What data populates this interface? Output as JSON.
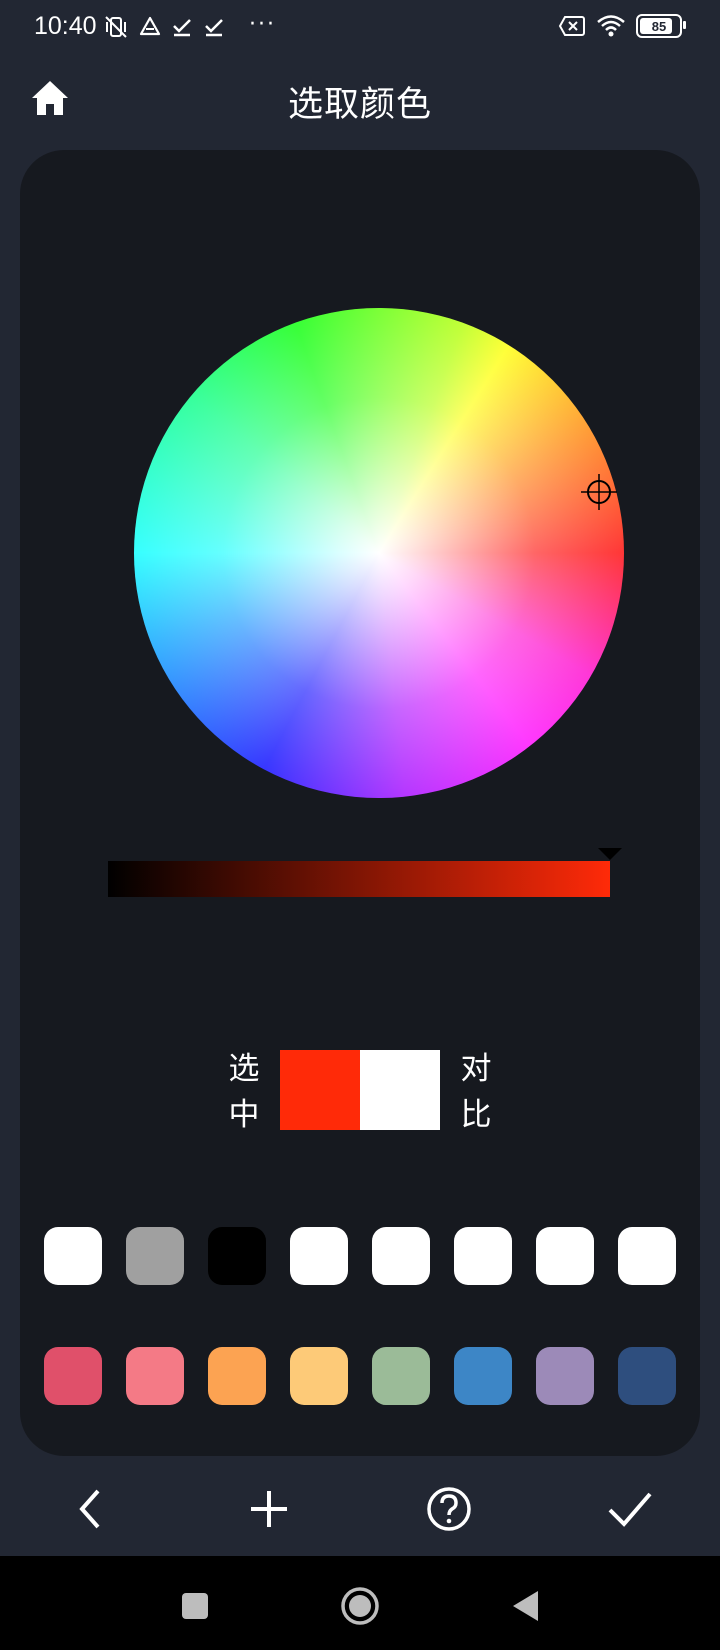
{
  "status_bar": {
    "time": "10:40",
    "battery": "85",
    "more": "···"
  },
  "app_bar": {
    "title": "选取颜色"
  },
  "compare": {
    "selected_label": "选\n中",
    "compare_label": "对\n比",
    "selected_color": "#ff2a08",
    "compare_color": "#ffffff"
  },
  "brightness": {
    "end_color": "#ff2a08",
    "level": 1.0
  },
  "swatches": {
    "row1": [
      "#ffffff",
      "#a0a0a0",
      "#000000",
      "#ffffff",
      "#ffffff",
      "#ffffff",
      "#ffffff",
      "#ffffff"
    ],
    "row2": [
      "#e0506a",
      "#f47a86",
      "#fca352",
      "#fdca78",
      "#9bbb98",
      "#3d86c6",
      "#9c8ab8",
      "#2e4e7e"
    ]
  },
  "icons": {
    "status_left": [
      "vibrate-off-icon",
      "drive-icon",
      "check-icon",
      "check-icon"
    ],
    "status_right": [
      "sim-off-icon",
      "wifi-icon",
      "battery-icon"
    ],
    "app_bar": "home-icon",
    "toolbar": [
      "back-icon",
      "add-icon",
      "help-icon",
      "confirm-icon"
    ],
    "nav": [
      "recents-icon",
      "home-nav-icon",
      "back-nav-icon"
    ]
  }
}
